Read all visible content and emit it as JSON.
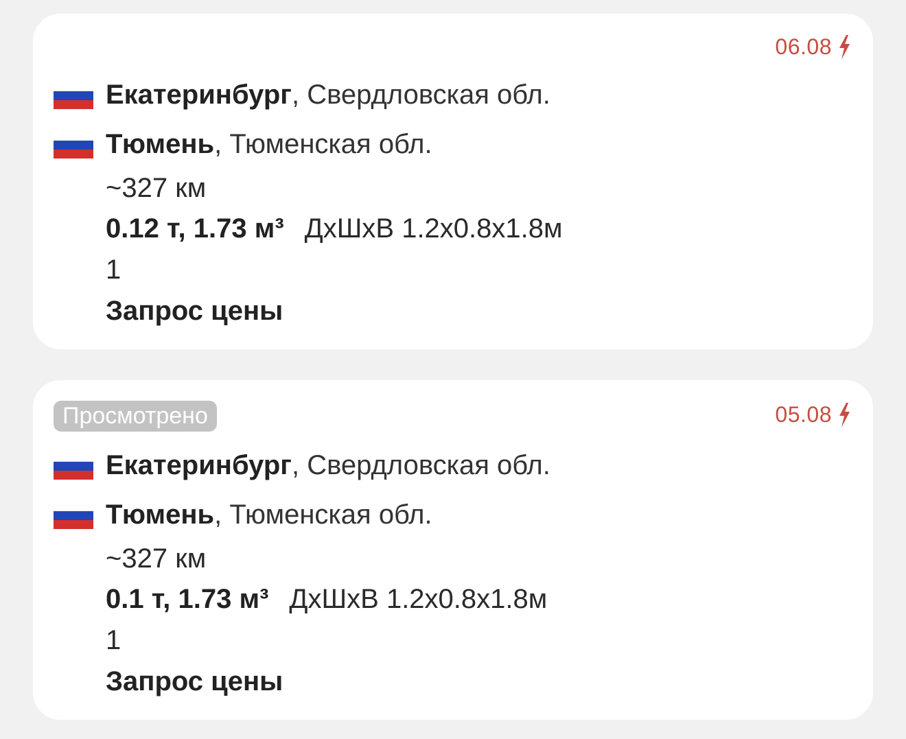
{
  "colors": {
    "date_accent": "#c94c42",
    "badge_bg": "#c3c3c3",
    "card_bg": "#ffffff",
    "page_bg": "#f1f1f2"
  },
  "cards": [
    {
      "badge": "",
      "date": "06.08",
      "date_icon": "lightning-bolt-icon",
      "from": {
        "flag": "russia-flag-icon",
        "city": "Екатеринбург",
        "region": ", Свердловская обл."
      },
      "to": {
        "flag": "russia-flag-icon",
        "city": "Тюмень",
        "region": ", Тюменская обл."
      },
      "distance": "~327 км",
      "weight_volume": "0.12 т, 1.73 м³",
      "dimensions": "ДхШхВ 1.2x0.8x1.8м",
      "quantity": "1",
      "price": "Запрос цены"
    },
    {
      "badge": "Просмотрено",
      "date": "05.08",
      "date_icon": "lightning-bolt-icon",
      "from": {
        "flag": "russia-flag-icon",
        "city": "Екатеринбург",
        "region": ", Свердловская обл."
      },
      "to": {
        "flag": "russia-flag-icon",
        "city": "Тюмень",
        "region": ", Тюменская обл."
      },
      "distance": "~327 км",
      "weight_volume": "0.1 т, 1.73 м³",
      "dimensions": "ДхШхВ 1.2x0.8x1.8м",
      "quantity": "1",
      "price": "Запрос цены"
    }
  ]
}
